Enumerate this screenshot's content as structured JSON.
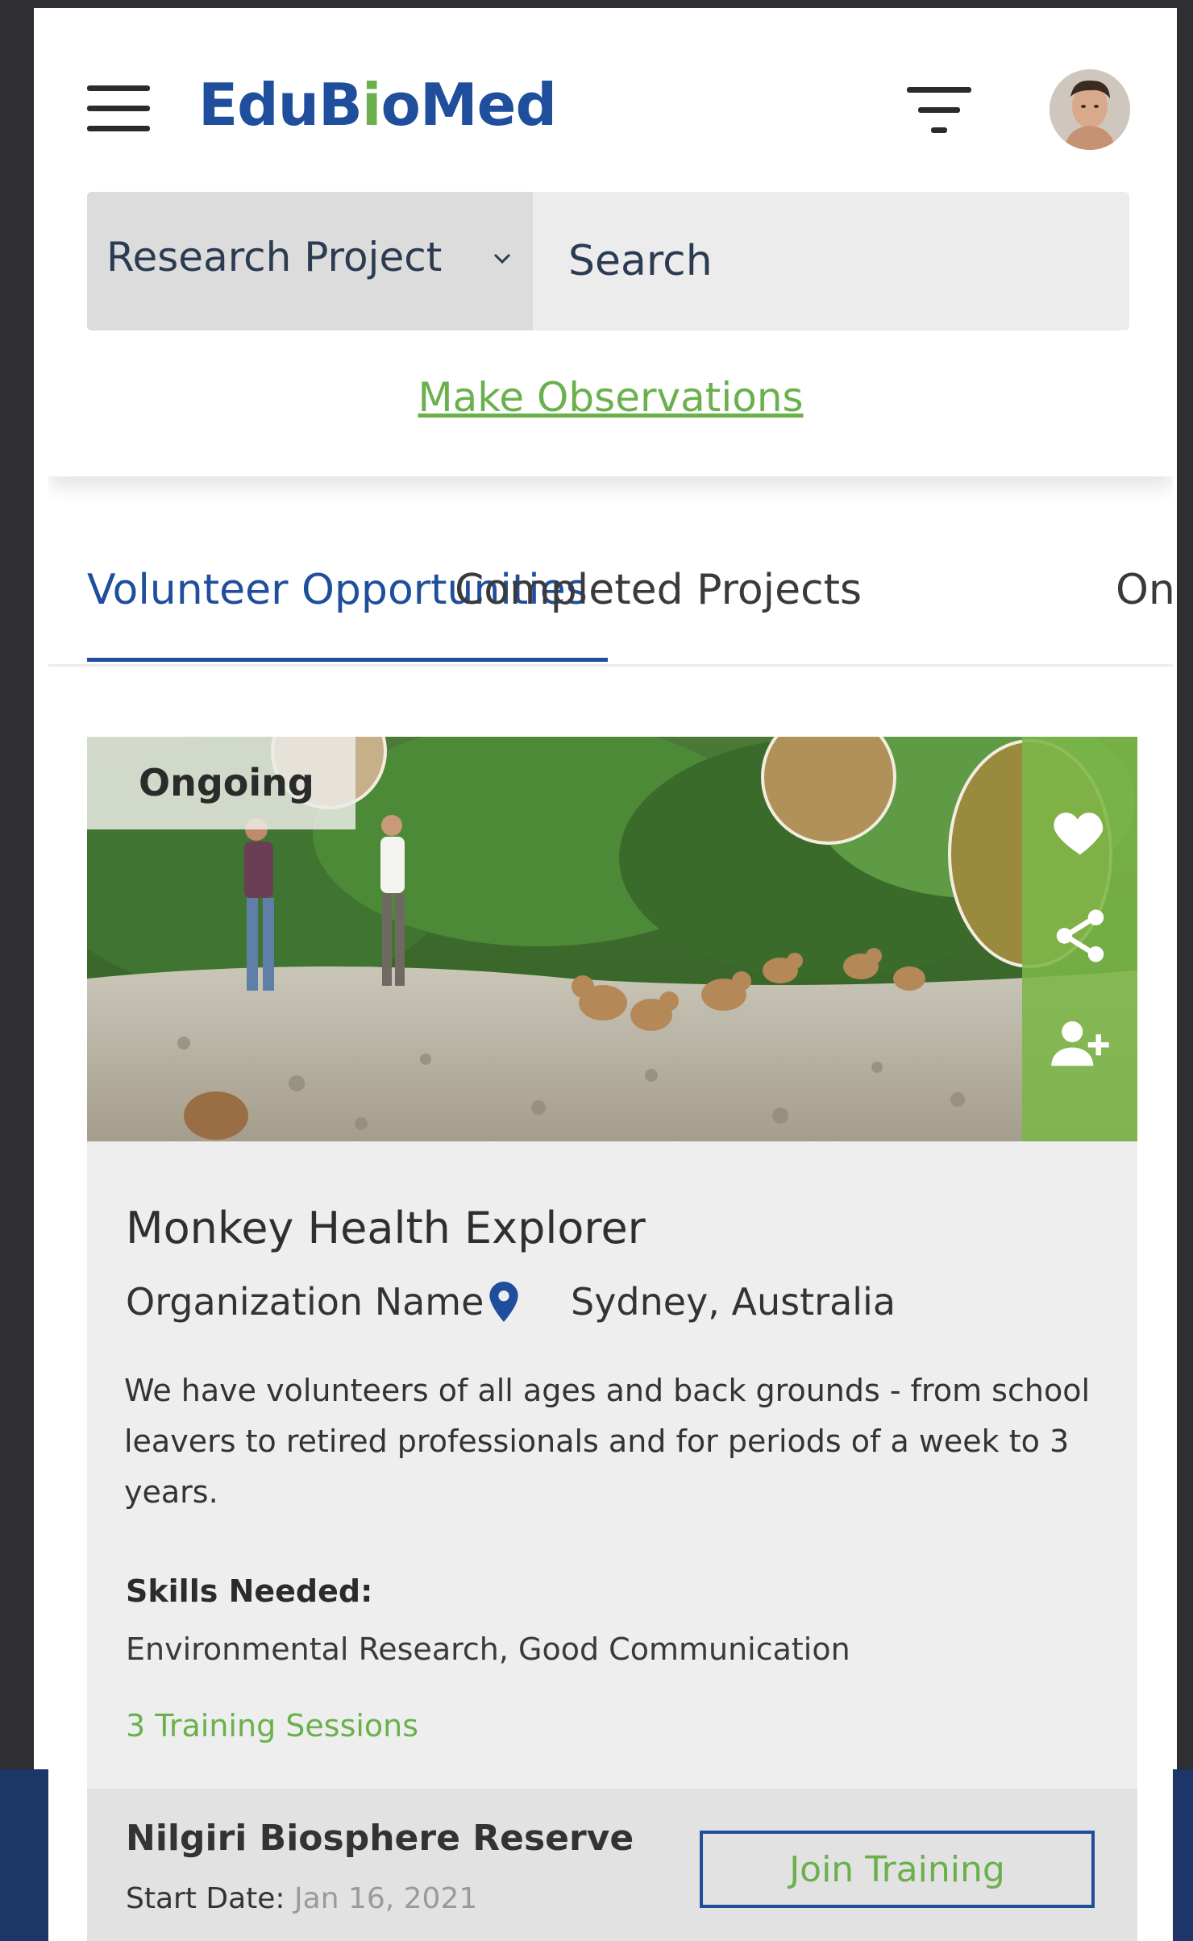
{
  "header": {
    "logo_text_1": "EduB",
    "logo_leaf": "i",
    "logo_text_2": "oMed",
    "menu_icon": "hamburger-menu-icon",
    "filter_icon": "filter-icon",
    "avatar_icon": "user-avatar"
  },
  "search": {
    "category_selected": "Research Project",
    "placeholder": "Search"
  },
  "links": {
    "make_observations": "Make Observations"
  },
  "tabs": [
    {
      "label": "Volunteer Opportunities",
      "active": true
    },
    {
      "label": "Completed Projects",
      "active": false
    },
    {
      "label": "On",
      "active": false
    }
  ],
  "card": {
    "status": "Ongoing",
    "title": "Monkey Health Explorer",
    "organization": "Organization Name",
    "location": "Sydney, Australia",
    "description": "We have volunteers of all ages and back grounds - from school leavers to retired professionals and for periods of a week to 3 years.",
    "skills_heading": "Skills Needed:",
    "skills": "Environmental Research, Good Communication",
    "training_sessions": "3 Training Sessions",
    "venue": "Nilgiri Biosphere Reserve",
    "start_label": "Start Date:",
    "start_date": "Jan 16, 2021",
    "join_button": "Join Training",
    "actions": [
      "heart-icon",
      "share-icon",
      "add-user-icon"
    ]
  },
  "colors": {
    "brand_blue": "#1f4e9c",
    "accent_green": "#6ab04c"
  }
}
